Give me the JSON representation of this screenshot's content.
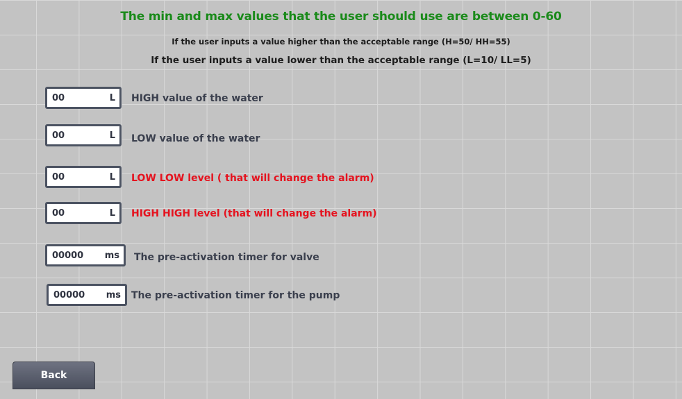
{
  "header": {
    "title": "The min and max values that the user should use are between 0-60",
    "line1": "If the user inputs a value higher than the acceptable range (H=50/ HH=55)",
    "line2": "If the user inputs a value lower than the acceptable range (L=10/ LL=5)"
  },
  "fields": [
    {
      "value": "00",
      "unit": "L",
      "label": "HIGH value of the water"
    },
    {
      "value": "00",
      "unit": "L",
      "label": "LOW value of the water"
    },
    {
      "value": "00",
      "unit": "L",
      "label": "LOW LOW level ( that will change the alarm)"
    },
    {
      "value": "00",
      "unit": "L",
      "label": "HIGH HIGH level (that will change the alarm)"
    },
    {
      "value": "00000",
      "unit": "ms",
      "label": "The pre-activation timer for valve"
    },
    {
      "value": "00000",
      "unit": "ms",
      "label": "The pre-activation timer for the pump"
    }
  ],
  "back_button": {
    "label": "Back"
  },
  "colors": {
    "title": "#1a8a1a",
    "alarm_label": "#e5121e",
    "background": "#c3c3c3"
  }
}
